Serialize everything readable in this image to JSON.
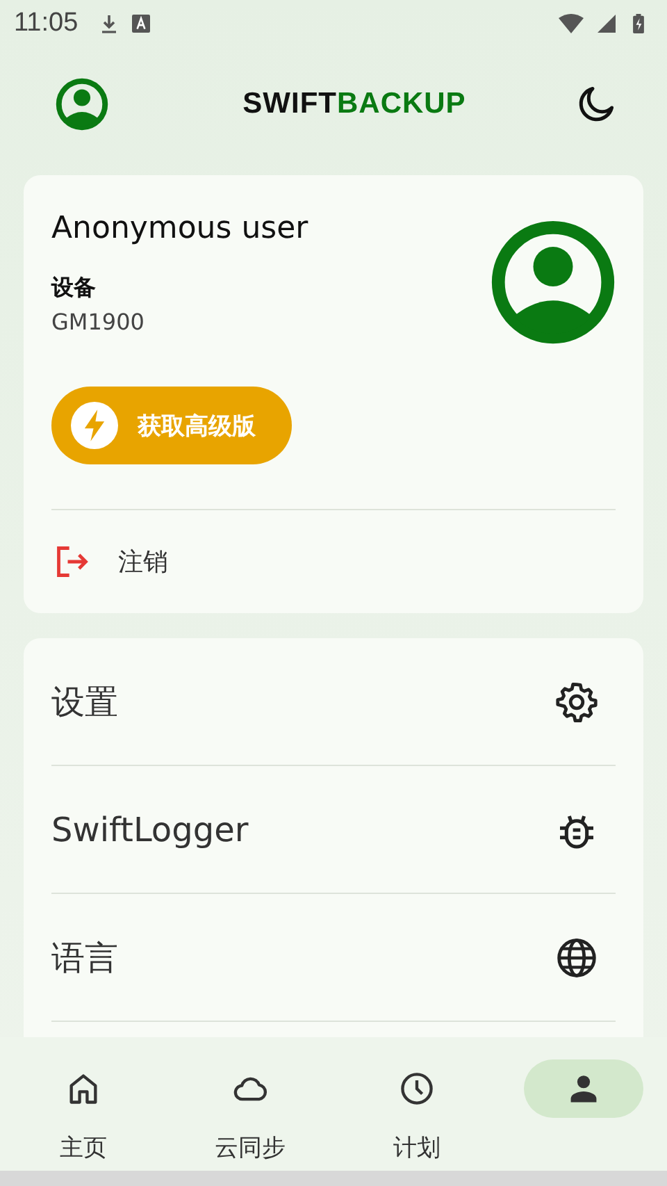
{
  "status_bar": {
    "time": "11:05"
  },
  "header": {
    "title_part_1": "SWIFT",
    "title_part_2": "BACKUP"
  },
  "account_card": {
    "name": "Anonymous user",
    "device_label": "设备",
    "device_value": "GM1900",
    "premium_button": "获取高级版",
    "logout": "注销"
  },
  "menu": [
    {
      "label": "设置",
      "kind": "settings"
    },
    {
      "label": "SwiftLogger",
      "kind": "bug"
    },
    {
      "label": "语言",
      "kind": "language"
    }
  ],
  "nav": [
    {
      "label": "主页",
      "kind": "home",
      "selected": false
    },
    {
      "label": "云同步",
      "kind": "cloud",
      "selected": false
    },
    {
      "label": "计划",
      "kind": "clock",
      "selected": false
    },
    {
      "kind": "person",
      "selected": true
    }
  ]
}
